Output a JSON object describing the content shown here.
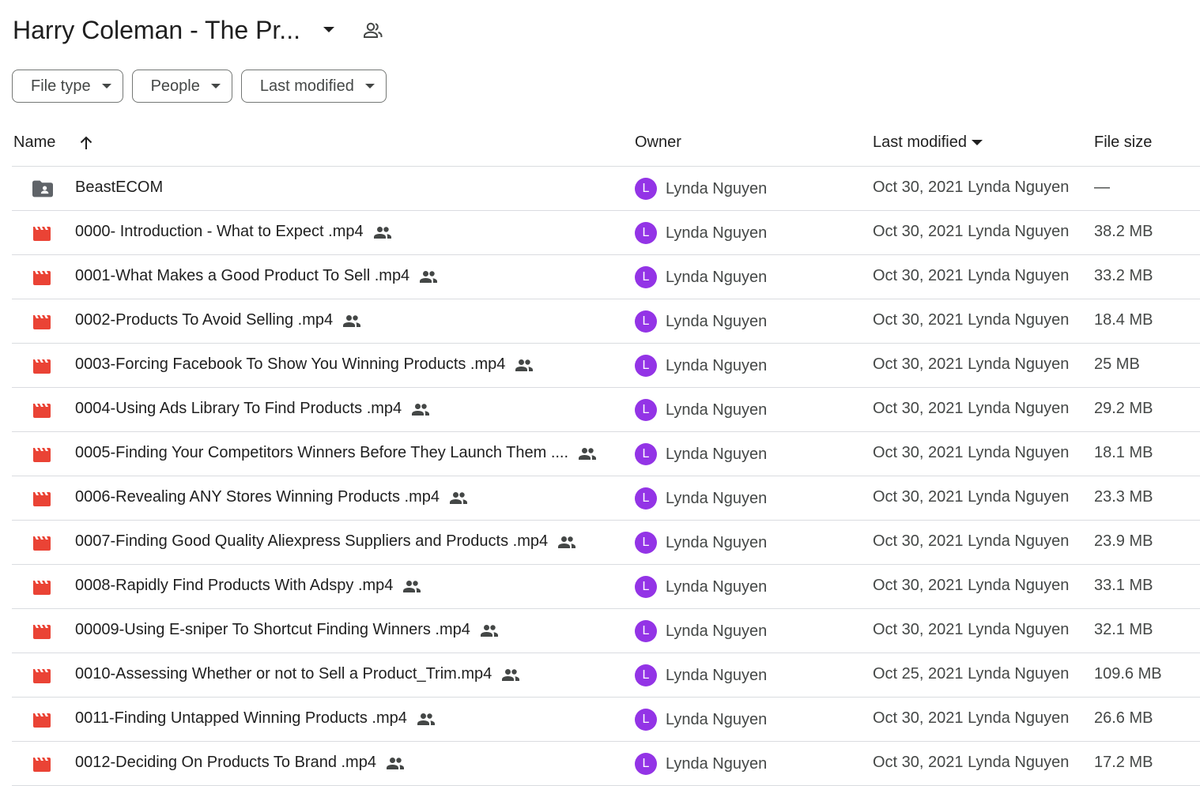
{
  "folder": {
    "title": "Harry Coleman - The Pr..."
  },
  "filters": {
    "file_type": "File type",
    "people": "People",
    "last_modified": "Last modified"
  },
  "columns": {
    "name": "Name",
    "owner": "Owner",
    "last_modified": "Last modified",
    "file_size": "File size"
  },
  "icons": {
    "folder": "shared-folder-icon",
    "video": "video-file-icon",
    "shared": "shared-people-icon"
  },
  "colors": {
    "video_icon": "#ea4335",
    "folder_icon": "#5f6368",
    "avatar": "#9334e6"
  },
  "files": [
    {
      "type": "folder",
      "name": "BeastECOM",
      "shared": false,
      "owner": "Lynda Nguyen",
      "owner_initial": "L",
      "modified": "Oct 30, 2021 Lynda Nguyen",
      "size": "—"
    },
    {
      "type": "video",
      "name": "0000- Introduction - What to Expect .mp4",
      "shared": true,
      "owner": "Lynda Nguyen",
      "owner_initial": "L",
      "modified": "Oct 30, 2021 Lynda Nguyen",
      "size": "38.2 MB"
    },
    {
      "type": "video",
      "name": "0001-What Makes a Good Product To Sell .mp4",
      "shared": true,
      "owner": "Lynda Nguyen",
      "owner_initial": "L",
      "modified": "Oct 30, 2021 Lynda Nguyen",
      "size": "33.2 MB"
    },
    {
      "type": "video",
      "name": "0002-Products To Avoid Selling .mp4",
      "shared": true,
      "owner": "Lynda Nguyen",
      "owner_initial": "L",
      "modified": "Oct 30, 2021 Lynda Nguyen",
      "size": "18.4 MB"
    },
    {
      "type": "video",
      "name": "0003-Forcing Facebook To Show You Winning Products .mp4",
      "shared": true,
      "owner": "Lynda Nguyen",
      "owner_initial": "L",
      "modified": "Oct 30, 2021 Lynda Nguyen",
      "size": "25 MB"
    },
    {
      "type": "video",
      "name": "0004-Using Ads Library To Find Products .mp4",
      "shared": true,
      "owner": "Lynda Nguyen",
      "owner_initial": "L",
      "modified": "Oct 30, 2021 Lynda Nguyen",
      "size": "29.2 MB"
    },
    {
      "type": "video",
      "name": "0005-Finding Your Competitors Winners Before They Launch Them ....",
      "shared": true,
      "owner": "Lynda Nguyen",
      "owner_initial": "L",
      "modified": "Oct 30, 2021 Lynda Nguyen",
      "size": "18.1 MB"
    },
    {
      "type": "video",
      "name": "0006-Revealing ANY Stores Winning Products .mp4",
      "shared": true,
      "owner": "Lynda Nguyen",
      "owner_initial": "L",
      "modified": "Oct 30, 2021 Lynda Nguyen",
      "size": "23.3 MB"
    },
    {
      "type": "video",
      "name": "0007-Finding Good Quality Aliexpress Suppliers and Products .mp4",
      "shared": true,
      "owner": "Lynda Nguyen",
      "owner_initial": "L",
      "modified": "Oct 30, 2021 Lynda Nguyen",
      "size": "23.9 MB"
    },
    {
      "type": "video",
      "name": "0008-Rapidly Find Products With Adspy .mp4",
      "shared": true,
      "owner": "Lynda Nguyen",
      "owner_initial": "L",
      "modified": "Oct 30, 2021 Lynda Nguyen",
      "size": "33.1 MB"
    },
    {
      "type": "video",
      "name": "00009-Using E-sniper To Shortcut Finding Winners .mp4",
      "shared": true,
      "owner": "Lynda Nguyen",
      "owner_initial": "L",
      "modified": "Oct 30, 2021 Lynda Nguyen",
      "size": "32.1 MB"
    },
    {
      "type": "video",
      "name": "0010-Assessing Whether or not to Sell a Product_Trim.mp4",
      "shared": true,
      "owner": "Lynda Nguyen",
      "owner_initial": "L",
      "modified": "Oct 25, 2021 Lynda Nguyen",
      "size": "109.6 MB"
    },
    {
      "type": "video",
      "name": "0011-Finding Untapped Winning Products .mp4",
      "shared": true,
      "owner": "Lynda Nguyen",
      "owner_initial": "L",
      "modified": "Oct 30, 2021 Lynda Nguyen",
      "size": "26.6 MB"
    },
    {
      "type": "video",
      "name": "0012-Deciding On Products To Brand .mp4",
      "shared": true,
      "owner": "Lynda Nguyen",
      "owner_initial": "L",
      "modified": "Oct 30, 2021 Lynda Nguyen",
      "size": "17.2 MB"
    }
  ]
}
